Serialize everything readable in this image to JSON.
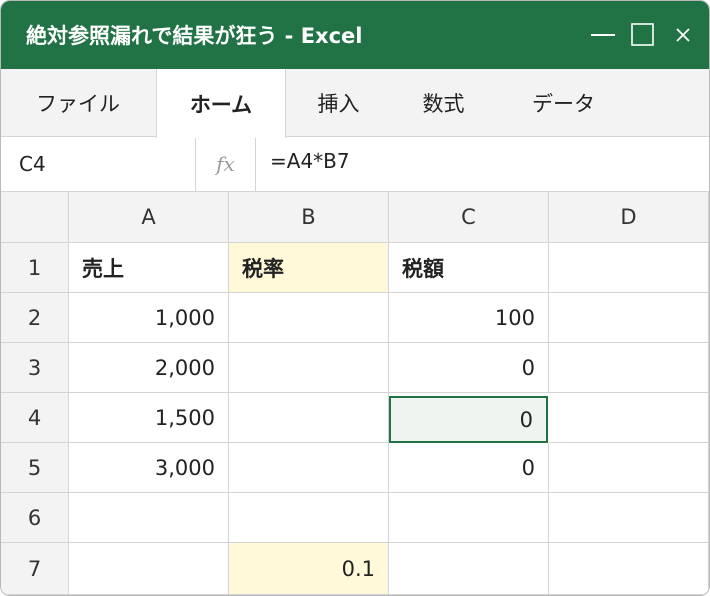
{
  "window": {
    "title": "絶対参照漏れで結果が狂う - Excel",
    "accent_color": "#217346",
    "controls": [
      "minimize-icon",
      "maximize-icon",
      "close-icon"
    ]
  },
  "tabs": [
    "ファイル",
    "ホーム",
    "挿入",
    "数式",
    "データ"
  ],
  "active_tab": "ホーム",
  "formula_bar": {
    "name_box": "C4",
    "fx_label": "fx",
    "formula": "=A4*B7"
  },
  "sheet": {
    "columns": [
      "A",
      "B",
      "C",
      "D"
    ],
    "rows": [
      "1",
      "2",
      "3",
      "4",
      "5",
      "6",
      "7"
    ],
    "cells": {
      "A1": "売上",
      "B1": "税率",
      "C1": "税額",
      "A2": "1,000",
      "C2": "100",
      "A3": "2,000",
      "C3": "0",
      "A4": "1,500",
      "C4": "0",
      "A5": "3,000",
      "C5": "0",
      "B7": "0.1"
    },
    "selected_cell": "C4",
    "highlight_color": "#fff8d9"
  }
}
